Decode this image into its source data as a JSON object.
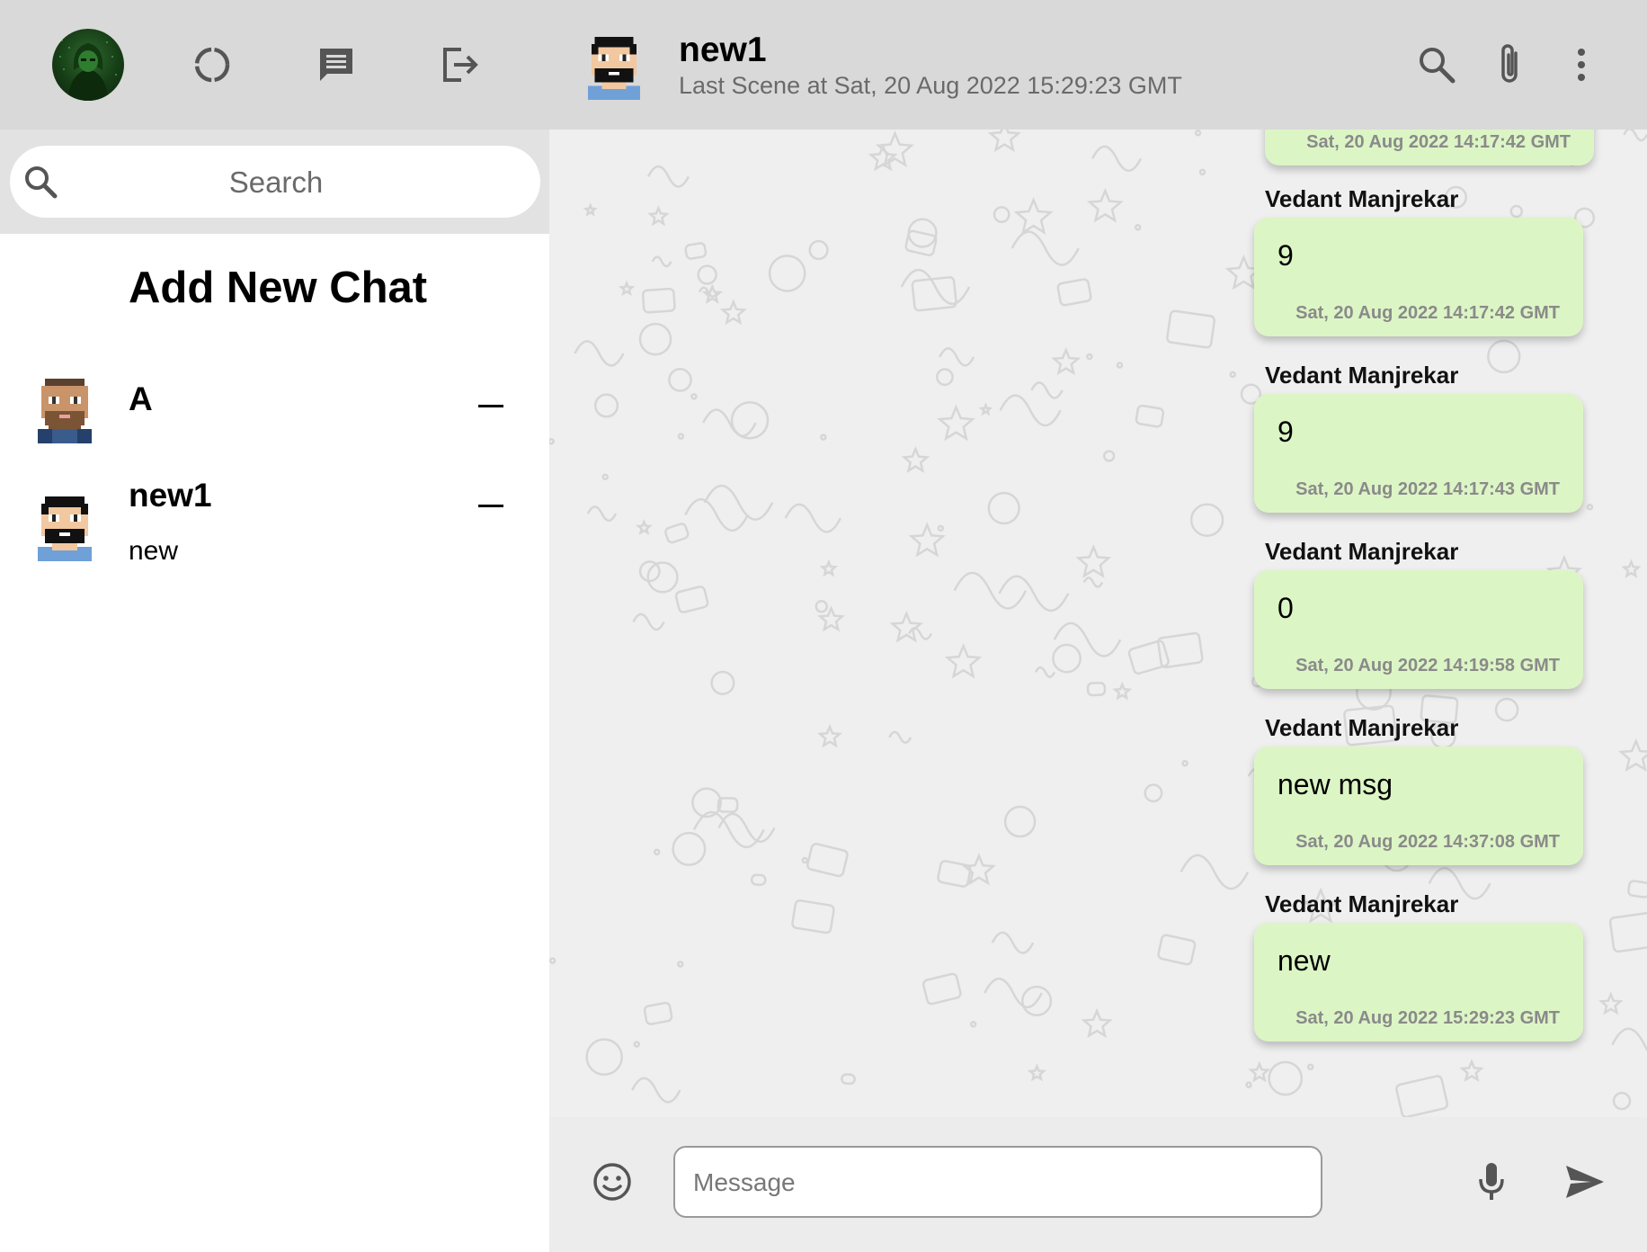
{
  "colors": {
    "header_bg": "#d9d9d9",
    "search_bg": "#e2e2e2",
    "bubble_bg": "#dcf5c5",
    "chat_bg": "#efefef",
    "footer_bg": "#ececec"
  },
  "sidebar": {
    "header_icons": [
      "profile-avatar",
      "status-icon",
      "new-chat-icon",
      "logout-icon"
    ],
    "search_placeholder": "Search",
    "add_new_chat": "Add New Chat",
    "chats": [
      {
        "name": "A",
        "last_message": ""
      },
      {
        "name": "new1",
        "last_message": "new"
      }
    ]
  },
  "chat": {
    "title": "new1",
    "subtitle": "Last Scene at Sat, 20 Aug 2022 15:29:23 GMT",
    "header_icons": [
      "search-icon",
      "attach-icon",
      "more-vert-icon"
    ],
    "partial_top_time": "Sat, 20 Aug 2022 14:17:42 GMT",
    "messages": [
      {
        "sender": "Vedant Manjrekar",
        "text": "9",
        "time": "Sat, 20 Aug 2022 14:17:42 GMT"
      },
      {
        "sender": "Vedant Manjrekar",
        "text": "9",
        "time": "Sat, 20 Aug 2022 14:17:43 GMT"
      },
      {
        "sender": "Vedant Manjrekar",
        "text": "0",
        "time": "Sat, 20 Aug 2022 14:19:58 GMT"
      },
      {
        "sender": "Vedant Manjrekar",
        "text": "new msg",
        "time": "Sat, 20 Aug 2022 14:37:08 GMT"
      },
      {
        "sender": "Vedant Manjrekar",
        "text": "new",
        "time": "Sat, 20 Aug 2022 15:29:23 GMT"
      }
    ],
    "input_placeholder": "Message",
    "footer_icons": [
      "emoji-icon",
      "mic-icon",
      "send-icon"
    ]
  }
}
